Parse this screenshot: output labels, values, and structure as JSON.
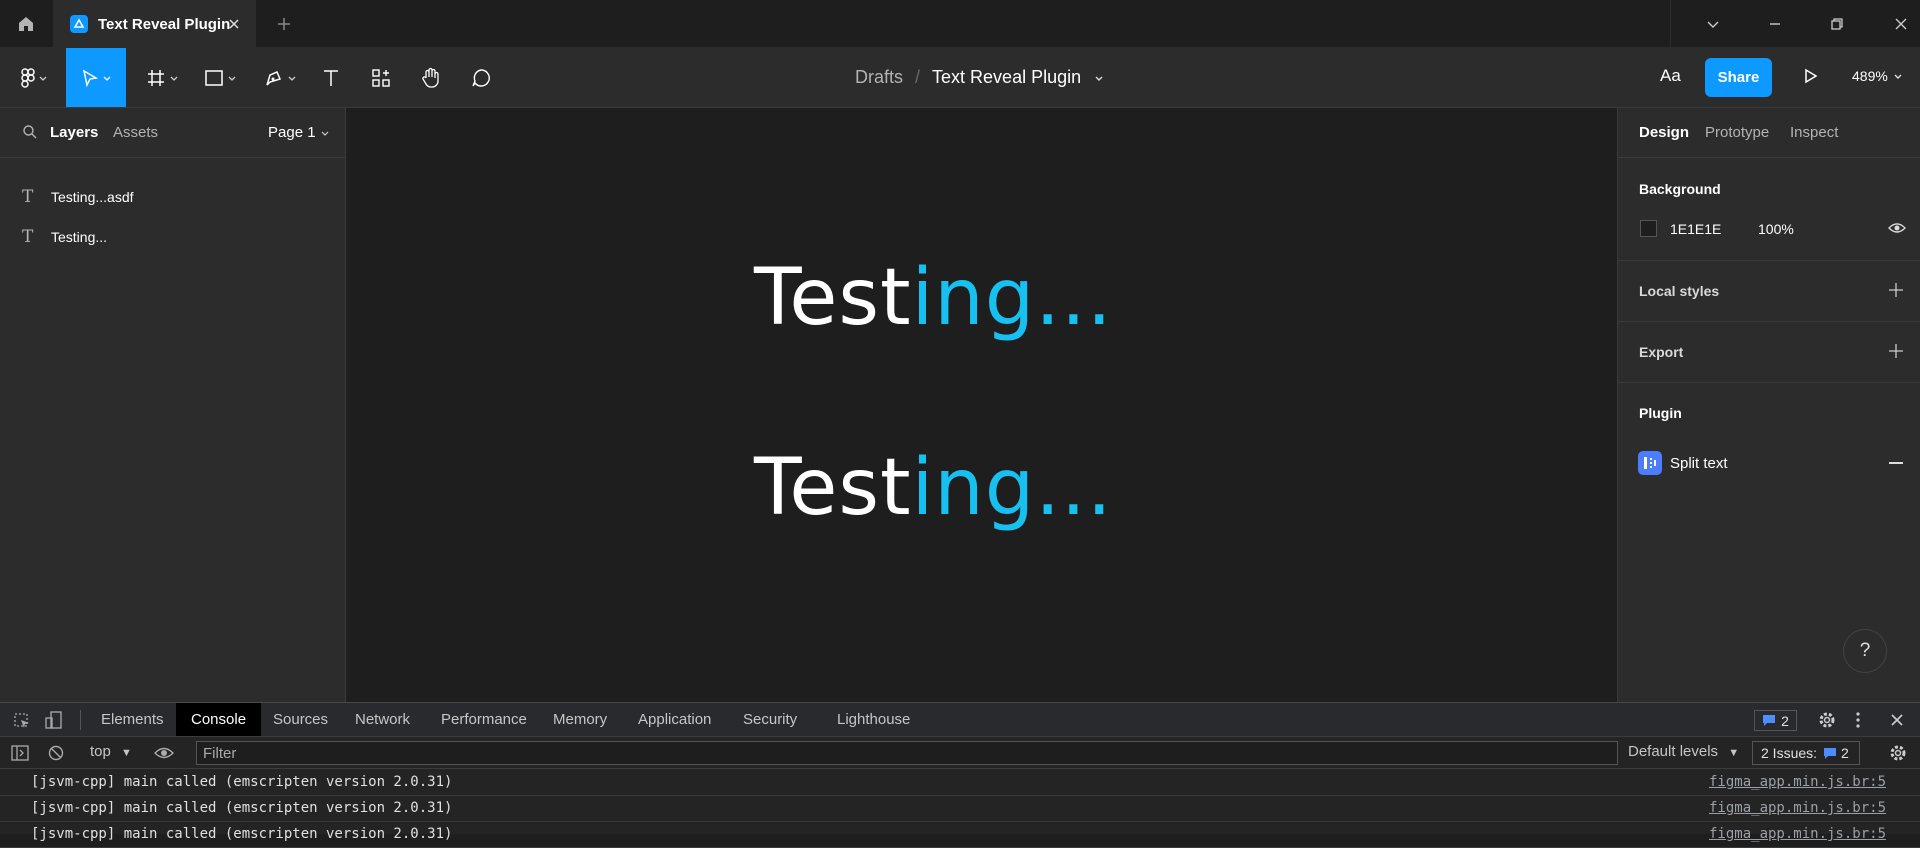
{
  "tab": {
    "title": "Text Reveal Plugin"
  },
  "toolbar": {
    "breadcrumb_root": "Drafts",
    "breadcrumb_sep": "/",
    "file_name": "Text Reveal Plugin",
    "font_button": "Aa",
    "share_label": "Share",
    "zoom": "489%"
  },
  "left_panel": {
    "tab_layers": "Layers",
    "tab_assets": "Assets",
    "page": "Page 1",
    "layers": [
      {
        "name": "Testing...asdf"
      },
      {
        "name": "Testing..."
      }
    ]
  },
  "canvas": {
    "texts": [
      {
        "plain": "Test",
        "highlight": "ing..."
      },
      {
        "plain": "Test",
        "highlight": "ing..."
      }
    ],
    "highlight_color": "#18c0f0"
  },
  "right_panel": {
    "tab_design": "Design",
    "tab_prototype": "Prototype",
    "tab_inspect": "Inspect",
    "background_title": "Background",
    "background_hex": "1E1E1E",
    "background_opacity": "100%",
    "local_styles": "Local styles",
    "export": "Export",
    "plugin_title": "Plugin",
    "plugin_name": "Split text",
    "help": "?"
  },
  "devtools": {
    "tabs": [
      "Elements",
      "Console",
      "Sources",
      "Network",
      "Performance",
      "Memory",
      "Application",
      "Security",
      "Lighthouse"
    ],
    "message_badge": "2",
    "context": "top",
    "filter_placeholder": "Filter",
    "levels": "Default levels",
    "issues": "2 Issues:",
    "issues_count": "2",
    "logs": [
      {
        "message": "[jsvm-cpp] main called (emscripten version 2.0.31)",
        "source": "figma_app.min.js.br:5"
      },
      {
        "message": "[jsvm-cpp] main called (emscripten version 2.0.31)",
        "source": "figma_app.min.js.br:5"
      },
      {
        "message": "[jsvm-cpp] main called (emscripten version 2.0.31)",
        "source": "figma_app.min.js.br:5"
      }
    ]
  },
  "colors": {
    "accent": "#0d99ff",
    "bg": "#1e1e1e",
    "panel": "#2c2c2c"
  }
}
